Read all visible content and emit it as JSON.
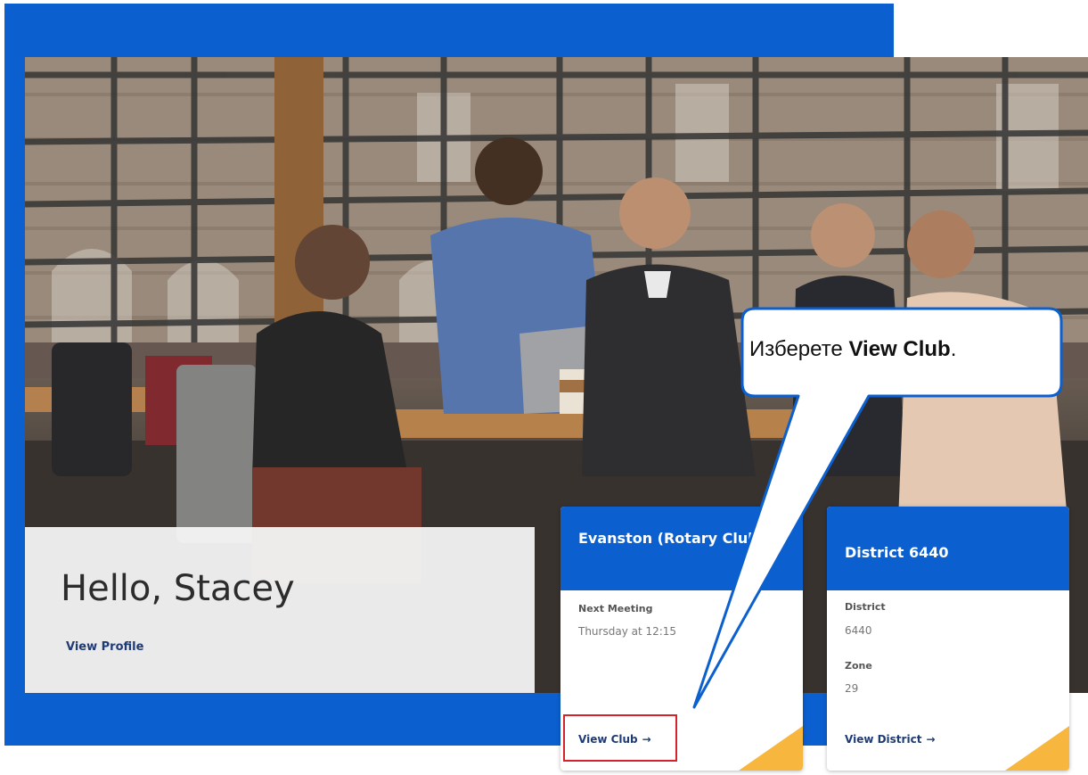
{
  "greeting": {
    "title": "Hello, Stacey",
    "profile_link": "View Profile"
  },
  "cards": {
    "club": {
      "title": "Evanston (Rotary Club)",
      "fields": [
        {
          "label": "Next Meeting",
          "value": "Thursday at 12:15"
        }
      ],
      "link": "View Club",
      "link_arrow": "→"
    },
    "district": {
      "title": "District 6440",
      "fields": [
        {
          "label": "District",
          "value": "6440"
        },
        {
          "label": "Zone",
          "value": "29"
        }
      ],
      "link": "View District",
      "link_arrow": "→"
    }
  },
  "callout": {
    "prefix": "Изберете ",
    "emphasis": "View Club",
    "suffix": "."
  },
  "colors": {
    "brand_blue": "#0b5fcf",
    "accent_gold": "#f7b63d",
    "link_navy": "#1f3b73",
    "highlight_red": "#d4232d",
    "callout_border": "#0b5fcf"
  },
  "icons": {
    "link_arrow": "arrow-right-icon"
  }
}
